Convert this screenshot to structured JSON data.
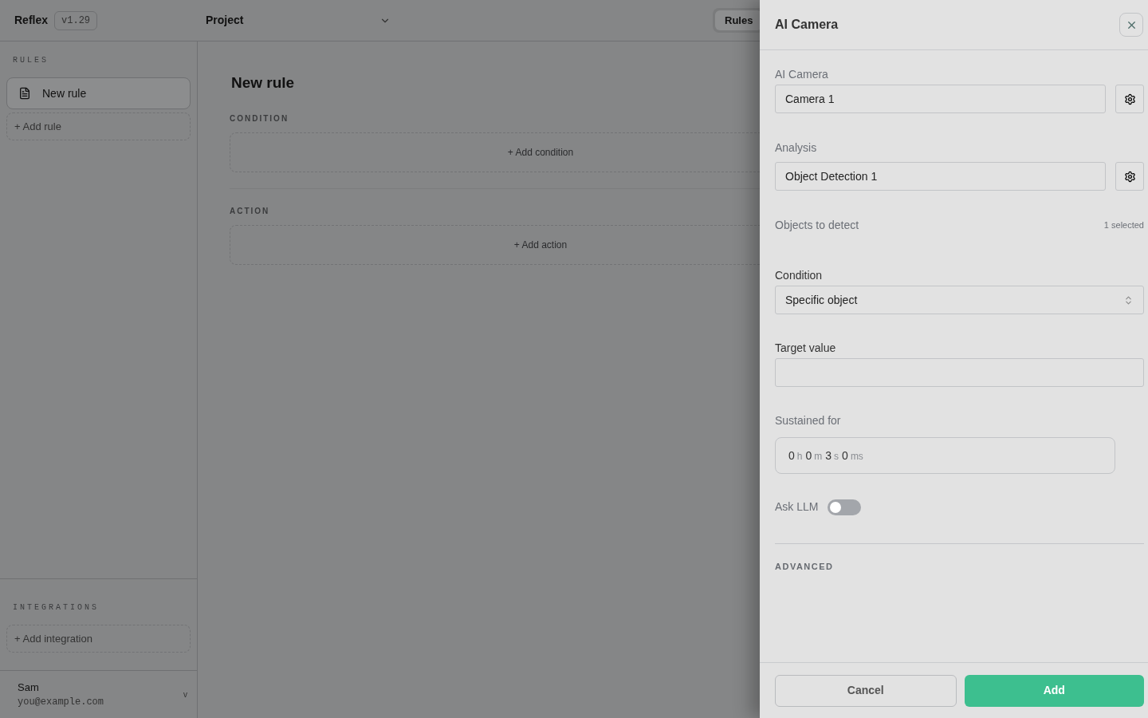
{
  "app": {
    "name": "Reflex",
    "version": "v1.29"
  },
  "project_selector": {
    "label": "Project"
  },
  "tabs": [
    {
      "label": "Rules",
      "selected": true
    }
  ],
  "sidebar": {
    "rules_heading": "RULES",
    "rules": [
      {
        "label": "New rule",
        "selected": true
      }
    ],
    "add_rule": "+ Add rule",
    "integrations_heading": "INTEGRATIONS",
    "add_integration": "+ Add integration",
    "user": {
      "name": "Sam",
      "email": "you@example.com",
      "caret": "v"
    }
  },
  "main": {
    "title": "New rule",
    "condition_heading": "CONDITION",
    "add_condition": "+ Add condition",
    "action_heading": "ACTION",
    "add_action": "+ Add action"
  },
  "panel": {
    "title": "AI Camera",
    "camera": {
      "label": "AI Camera",
      "value": "Camera 1"
    },
    "analysis": {
      "label": "Analysis",
      "value": "Object Detection 1"
    },
    "objects": {
      "label": "Objects to detect",
      "count": "1 selected"
    },
    "condition": {
      "label": "Condition",
      "value": "Specific object"
    },
    "target": {
      "label": "Target value"
    },
    "sustained": {
      "label": "Sustained for",
      "parts": [
        {
          "value": "0",
          "unit": "h"
        },
        {
          "value": "0",
          "unit": "m"
        },
        {
          "value": "3",
          "unit": "s"
        },
        {
          "value": "0",
          "unit": "ms"
        }
      ]
    },
    "ask_llm": {
      "label": "Ask LLM",
      "on": false
    },
    "advanced_heading": "ADVANCED",
    "cancel": "Cancel",
    "add": "Add"
  }
}
